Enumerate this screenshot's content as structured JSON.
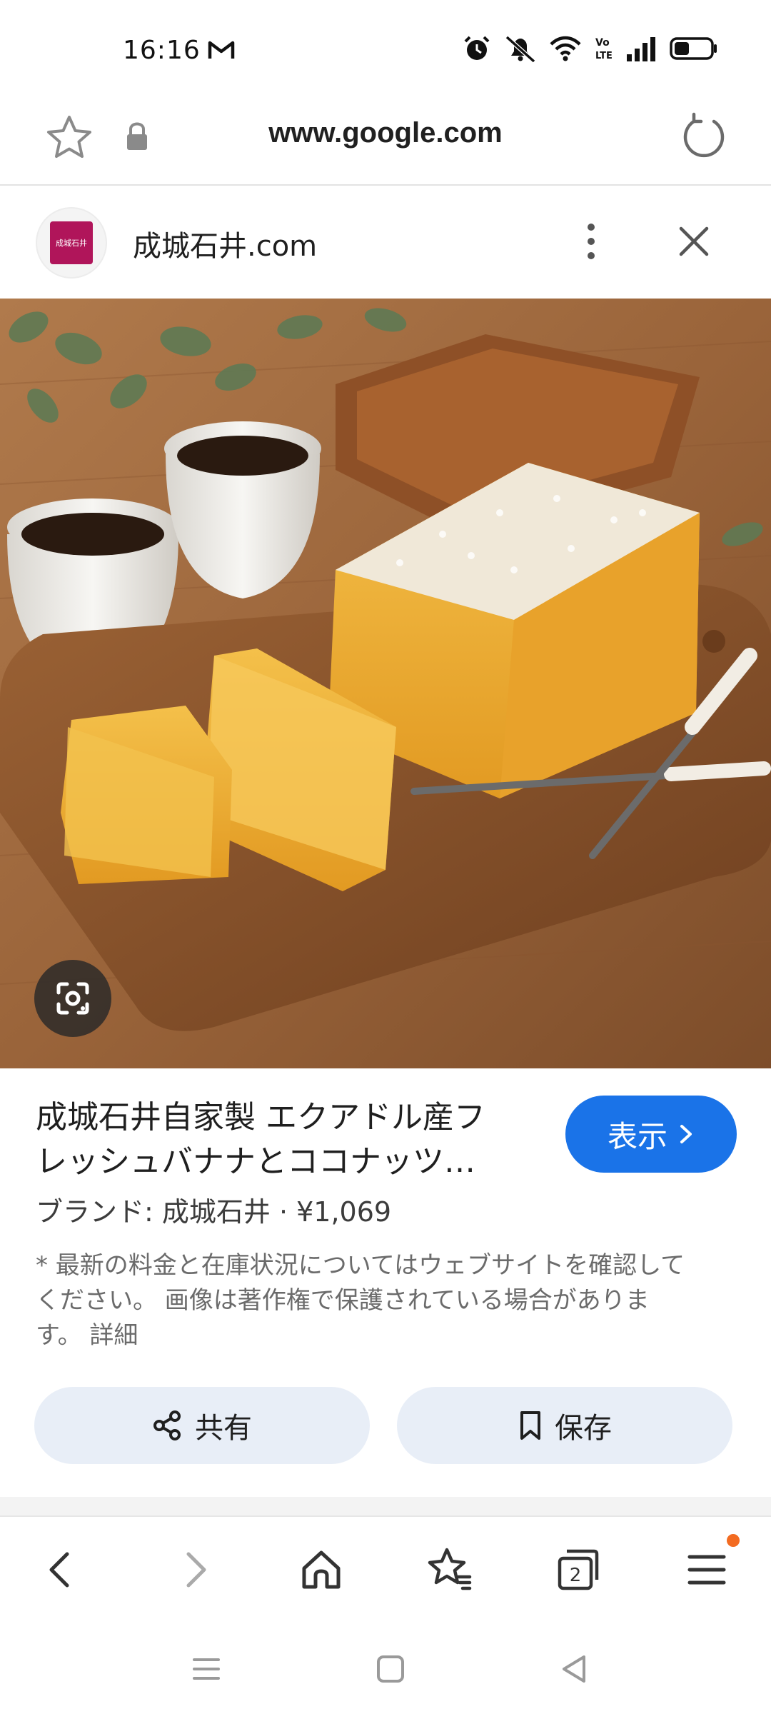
{
  "status_bar": {
    "time": "16:16",
    "icons": [
      "gmail-icon",
      "alarm-icon",
      "mute-icon",
      "wifi-icon",
      "volte-icon",
      "signal-icon",
      "battery-icon"
    ]
  },
  "url_bar": {
    "url": "www.google.com"
  },
  "source": {
    "name": "成城石井.com",
    "logo_text": "成城石井"
  },
  "product": {
    "title_line1": "成城石井自家製 エクアドル産フ",
    "title_line2": "レッシュバナナとココナッツ…",
    "view_label": "表示",
    "brand_line": "ブランド: 成城石井 · ¥1,069",
    "notice_line1": "* 最新の料金と在庫状況についてはウェブサイトを確認して",
    "notice_line2": "ください。 画像は著作権で保護されている場合がありま",
    "notice_line3": "す。 詳細",
    "share_label": "共有",
    "save_label": "保存"
  },
  "colors": {
    "accent": "#1a73e8",
    "button_bg": "#e8eef7",
    "badge": "#f36b21",
    "brand_logo": "#b0155a"
  }
}
